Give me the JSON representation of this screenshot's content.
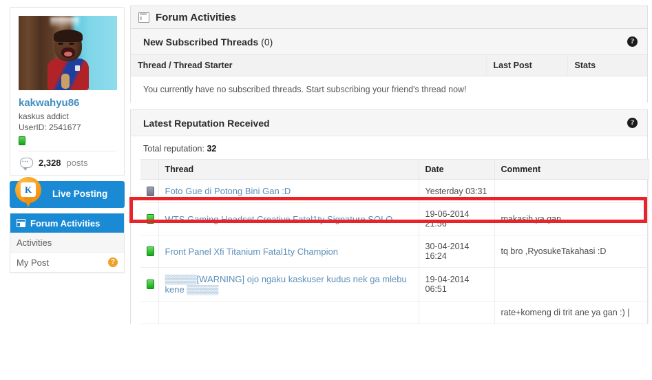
{
  "sidebar": {
    "profile": {
      "username": "kakwahyu86",
      "usertitle": "kaskus addict",
      "userid_label": "UserID: 2541677",
      "posts_count": "2,328",
      "posts_label": "posts",
      "avatar_alt": "user avatar photo of a laughing child"
    },
    "live_posting_label": "Live Posting",
    "live_posting_icon_text": "K",
    "forum_activities_header": "Forum Activities",
    "menu_items": [
      {
        "label": "Activities",
        "badge": ""
      },
      {
        "label": "My Post",
        "badge": "?"
      }
    ]
  },
  "main": {
    "window_title": "Forum Activities",
    "help_glyph": "?",
    "sections": [
      {
        "title": "New Subscribed Threads",
        "count": "(0)",
        "columns": [
          "Thread / Thread Starter",
          "Last Post",
          "Stats"
        ],
        "empty_message": "You currently have no subscribed threads. Start subscribing your friend's thread now!"
      },
      {
        "title": "Latest Reputation Received",
        "total_label": "Total reputation:",
        "total_value": "32",
        "columns": [
          "Thread",
          "Date",
          "Comment"
        ],
        "rows": [
          {
            "chip": "gray",
            "thread": "Foto Gue di Potong Bini Gan :D",
            "date": "Yesterday 03:31",
            "comment": "",
            "highlighted": true
          },
          {
            "chip": "green",
            "thread": "WTS Gaming Headset Creative Fatal1ty Signature SOLO",
            "date": "19-06-2014 21:56",
            "comment": "makasih ya gan",
            "highlighted": false
          },
          {
            "chip": "green",
            "thread": "Front Panel Xfi Titanium Fatal1ty Champion",
            "date": "30-04-2014 16:24",
            "comment": "tq bro ,RyosukeTakahasi :D",
            "highlighted": false
          },
          {
            "chip": "green",
            "thread": "▒▒▒▒▒[WARNING] ojo ngaku kaskuser kudus nek ga mlebu kene ▒▒▒▒▒",
            "date": "19-04-2014 06:51",
            "comment": "",
            "highlighted": false
          },
          {
            "chip": "",
            "thread": "",
            "date": "",
            "comment": "rate+komeng di trit ane ya gan :) |",
            "highlighted": false
          }
        ]
      }
    ]
  },
  "colors": {
    "accent_blue": "#1b8ad4",
    "link_blue": "#5b8fb9",
    "highlight_red": "#e8232a",
    "chip_green": "#18a618",
    "chip_gray": "#6d7585",
    "orange_badge": "#f0a02a"
  }
}
